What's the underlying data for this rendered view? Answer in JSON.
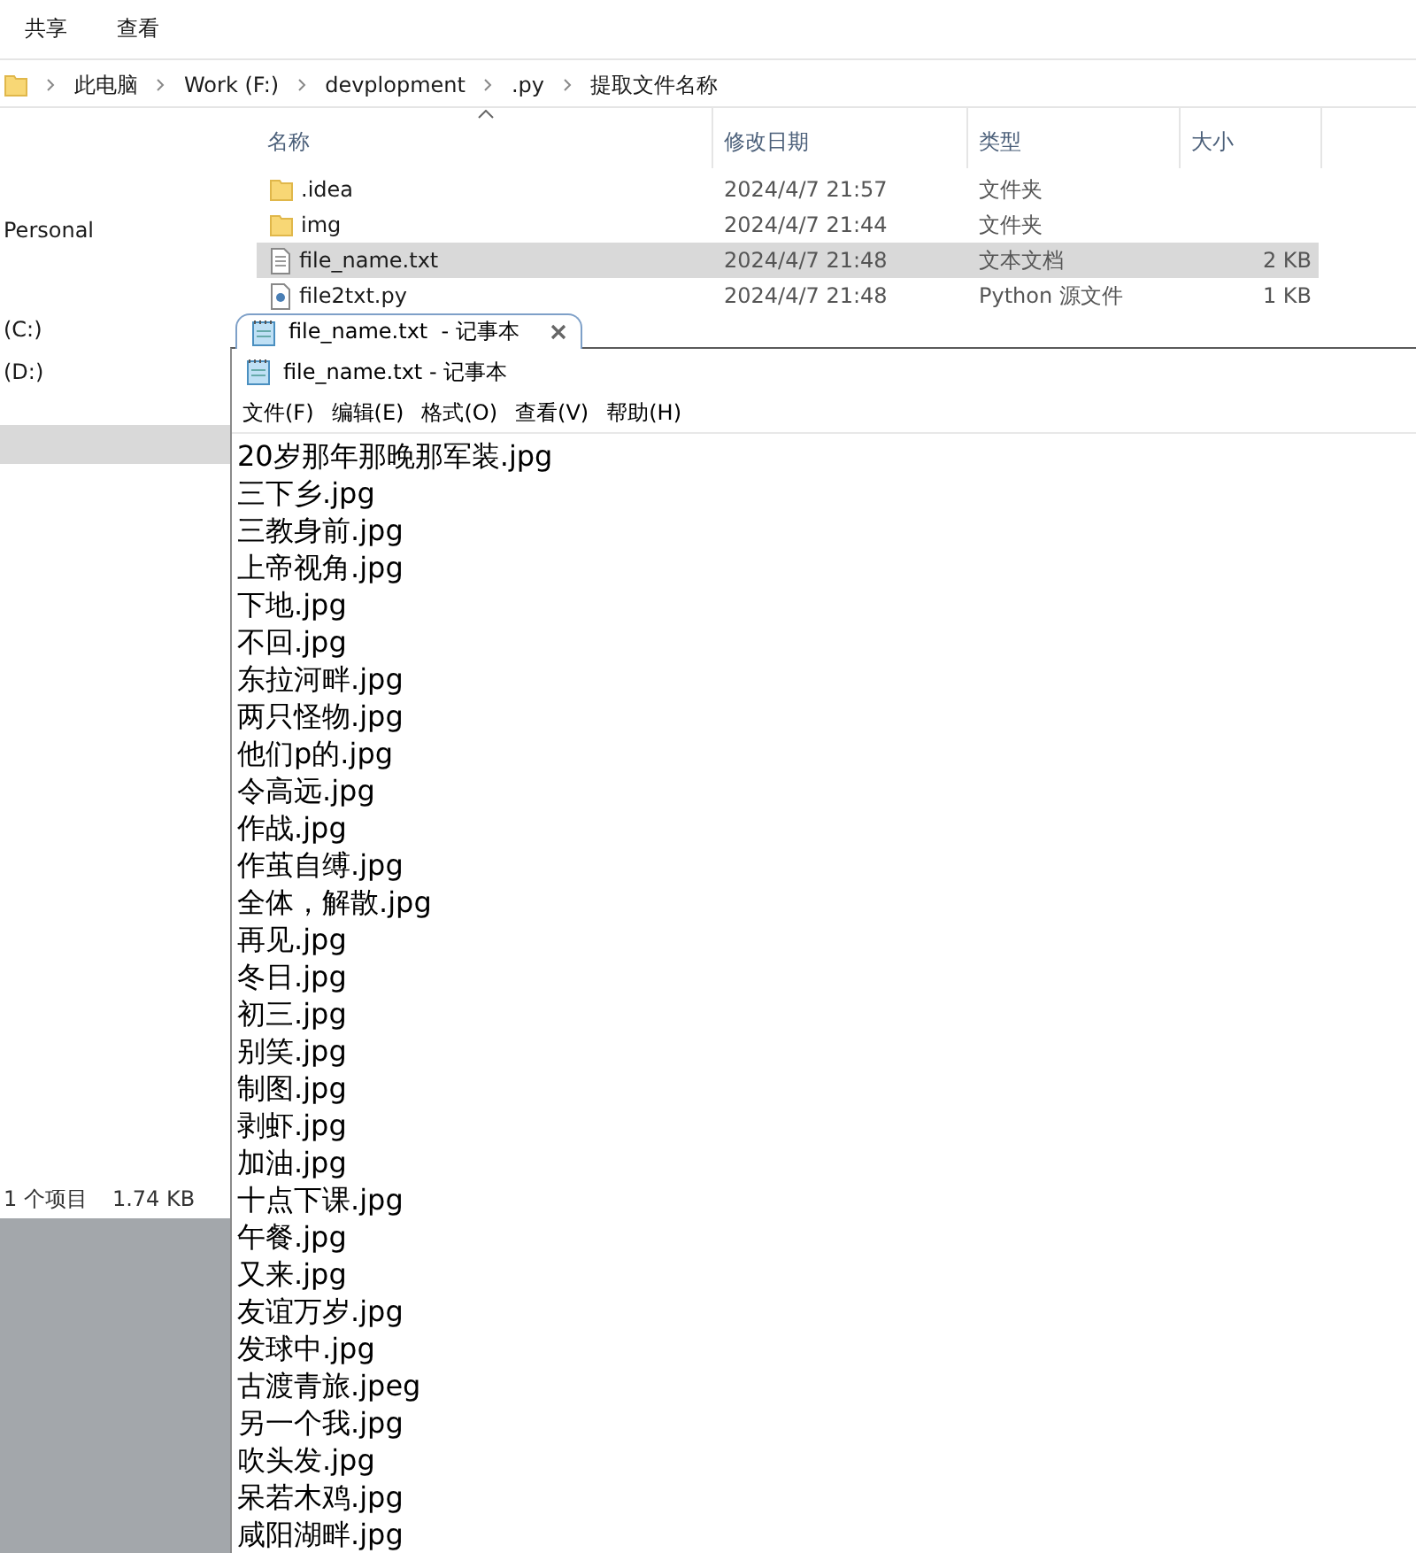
{
  "explorer": {
    "toolbar": [
      {
        "label": "共享"
      },
      {
        "label": "查看"
      }
    ],
    "breadcrumb": [
      "此电脑",
      "Work (F:)",
      "devplopment",
      ".py",
      "提取文件名称"
    ],
    "nav_items": [
      {
        "label": "Personal"
      },
      {
        "label": "(C:)"
      },
      {
        "label": "(D:)"
      }
    ],
    "columns": [
      {
        "label": "名称",
        "sorted": true
      },
      {
        "label": "修改日期",
        "sorted": false
      },
      {
        "label": "类型",
        "sorted": false
      },
      {
        "label": "大小",
        "sorted": false
      }
    ],
    "rows": [
      {
        "kind": "folder",
        "name": ".idea",
        "date": "2024/4/7 21:57",
        "type": "文件夹",
        "selected": false
      },
      {
        "kind": "folder",
        "name": "img",
        "date": "2024/4/7 21:44",
        "type": "文件夹",
        "selected": false
      },
      {
        "kind": "text",
        "name": "file_name.txt",
        "date": "2024/4/7 21:48",
        "type": "文本文档",
        "size": "2 KB",
        "selected": true
      },
      {
        "kind": "python",
        "name": "file2txt.py",
        "date": "2024/4/7 21:48",
        "type": "Python 源文件",
        "size": "1 KB",
        "selected": false
      }
    ],
    "status_bar": {
      "count": "1 个项目",
      "size": "1.74 KB"
    }
  },
  "notepad": {
    "tab_title": "file_name.txt  - 记事本",
    "title": "file_name.txt - 记事本",
    "menu": [
      "文件(F)",
      "编辑(E)",
      "格式(O)",
      "查看(V)",
      "帮助(H)"
    ],
    "lines": [
      "20岁那年那晚那军装.jpg",
      "三下乡.jpg",
      "三教身前.jpg",
      "上帝视角.jpg",
      "下地.jpg",
      "不回.jpg",
      "东拉河畔.jpg",
      "两只怪物.jpg",
      "他们p的.jpg",
      "令高远.jpg",
      "作战.jpg",
      "作茧自缚.jpg",
      "全体，解散.jpg",
      "再见.jpg",
      "冬日.jpg",
      "初三.jpg",
      "别笑.jpg",
      "制图.jpg",
      "剥虾.jpg",
      "加油.jpg",
      "十点下课.jpg",
      "午餐.jpg",
      "又来.jpg",
      "友谊万岁.jpg",
      "发球中.jpg",
      "古渡青旅.jpeg",
      "另一个我.jpg",
      "吹头发.jpg",
      "呆若木鸡.jpg",
      "咸阳湖畔.jpg"
    ]
  }
}
